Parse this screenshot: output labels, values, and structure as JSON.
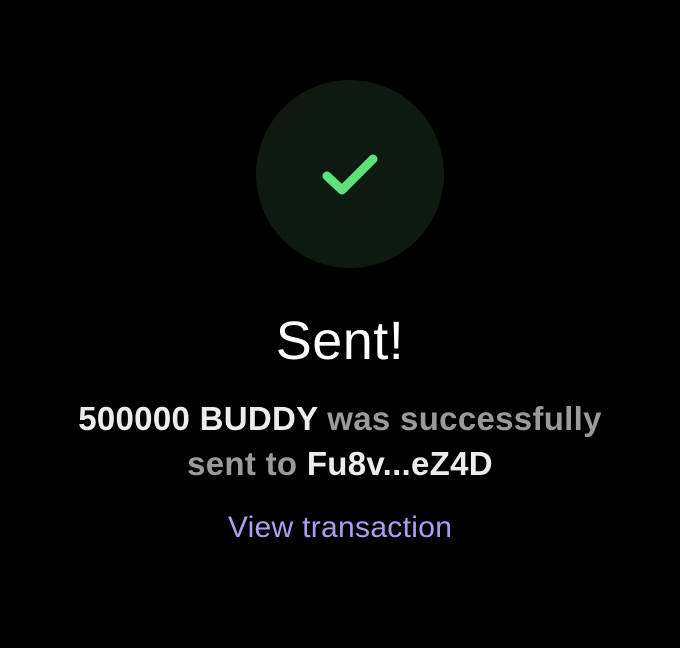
{
  "icons": {
    "status": "checkmark-icon"
  },
  "colors": {
    "background": "#000000",
    "circle": "#0e1a0f",
    "check": "#5ee07a",
    "title": "#ffffff",
    "highlight": "#ececec",
    "muted": "#9a9a9a",
    "link": "#ab9ff2"
  },
  "status": {
    "title": "Sent!",
    "amount": "500000 BUDDY",
    "message_middle": " was successfully sent to ",
    "recipient": "Fu8v...eZ4D"
  },
  "actions": {
    "view_transaction": "View transaction"
  }
}
